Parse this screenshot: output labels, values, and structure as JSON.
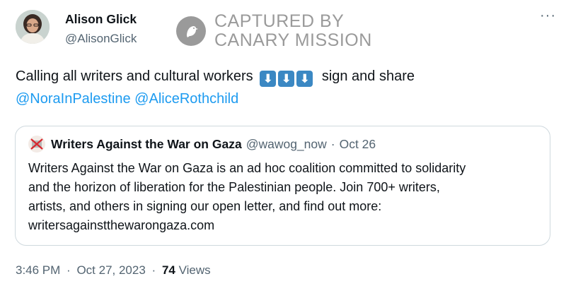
{
  "author": {
    "name": "Alison Glick",
    "handle": "@AlisonGlick"
  },
  "watermark": {
    "line1": "CAPTURED BY",
    "line2": "CANARY MISSION"
  },
  "more_icon": "more-horizontal-icon",
  "tweet": {
    "text_before": "Calling all writers and cultural workers",
    "arrows": [
      "⬇",
      "⬇",
      "⬇"
    ],
    "text_after": "sign and share",
    "mentions": [
      "@NoraInPalestine",
      "@AliceRothchild"
    ]
  },
  "quoted_tweet": {
    "name": "Writers Against the War on Gaza",
    "handle": "@wawog_now",
    "separator": "·",
    "date": "Oct 26",
    "text_lines": [
      "Writers Against the War on Gaza is an ad hoc coalition committed to solidarity",
      "and the horizon of liberation for the Palestinian people. Join 700+ writers,",
      "artists, and others in signing our open letter, and find out more:",
      "writersagainstthewarongaza.com"
    ]
  },
  "meta": {
    "time": "3:46 PM",
    "separator": "·",
    "date": "Oct 27, 2023",
    "views_count": "74",
    "views_label": "Views"
  },
  "colors": {
    "link": "#1d9bf0",
    "secondary_text": "#536471",
    "watermark": "#9a9a9a",
    "arrow_emoji_bg": "#3b88c3"
  }
}
